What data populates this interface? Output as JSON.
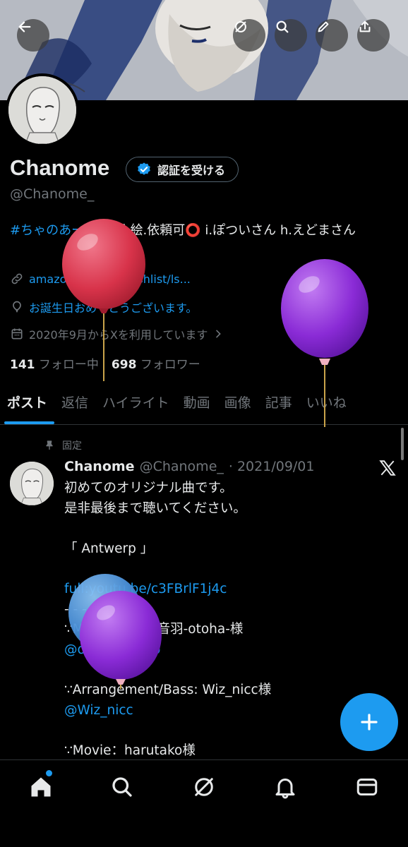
{
  "profile": {
    "name": "Chanome",
    "verify_label": "認証を受ける",
    "handle": "@Chanome_",
    "bio_tag": "#ちゃのあーと",
    "bio_text": " 歌唱.絵.依頼可⭕ i.ぽついさん h.えどまさん",
    "link": "amazon.co.jp/hz/wishlist/ls...",
    "birthday": "お誕生日おめでとうございます。",
    "joined": "2020年9月からXを利用しています",
    "following_count": "141",
    "following_label": "フォロー中",
    "followers_count": "698",
    "followers_label": "フォロワー"
  },
  "tabs": [
    "ポスト",
    "返信",
    "ハイライト",
    "動画",
    "画像",
    "記事",
    "いいね"
  ],
  "post": {
    "pinned_label": "固定",
    "author": "Chanome",
    "handle": "@Chanome_",
    "date": "· 2021/09/01",
    "line1": "初めてのオリジナル曲です。",
    "line2": "是非最後まで聴いてください。",
    "title": "「 Antwerp 」",
    "url": "full:youtu.be/c3FBrlF1j4c",
    "divider": "- - - - - - - - - -",
    "credit_music": "∵Music/Lyric：音羽-otoha-様",
    "mention_1": "@otoha_danso",
    "credit_arrangement": "∵Arrangement/Bass: Wiz_nicc様",
    "mention_2": "@Wiz_nicc",
    "credit_movie": "∵Movie：harutako様"
  },
  "icons": {
    "top_bar": [
      "back-arrow-icon",
      "grok-icon",
      "search-icon",
      "edit-icon",
      "share-icon"
    ],
    "bottom_nav": [
      "home-icon",
      "search-icon",
      "grok-icon",
      "bell-icon",
      "mail-icon"
    ],
    "fab": "plus-icon"
  },
  "colors": {
    "accent": "#1d9bf0",
    "background": "#000000",
    "muted_text": "#71767b",
    "balloon_red": "#d8334a",
    "balloon_purple": "#8a2bd6",
    "balloon_blue": "#4a90d9"
  }
}
